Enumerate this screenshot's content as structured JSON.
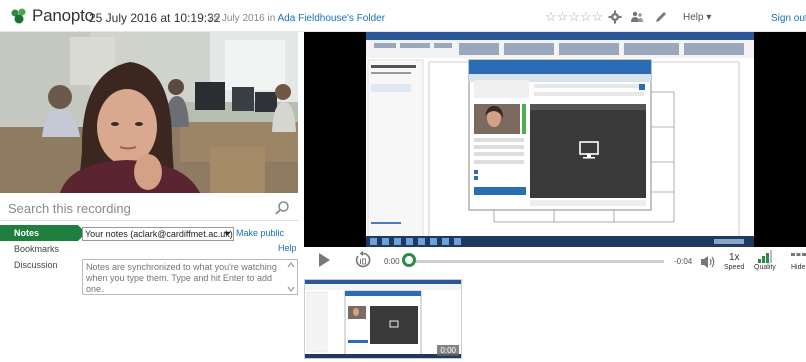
{
  "header": {
    "brand": "Panopto",
    "title": "25 July 2016 at 10:19:32",
    "subtitle_prefix": "25 July 2016 in",
    "folder": "Ada Fieldhouse's Folder",
    "rating_stars": "☆☆☆☆☆",
    "help_label": "Help ▾",
    "sign_out": "Sign out"
  },
  "search": {
    "placeholder": "Search this recording"
  },
  "tabs": [
    {
      "label": "Notes",
      "active": true
    },
    {
      "label": "Bookmarks",
      "active": false
    },
    {
      "label": "Discussion",
      "active": false
    }
  ],
  "notes": {
    "selected_stream": "Your notes (aclark@cardiffmet.ac.uk)",
    "make_public": "Make public",
    "help": "Help",
    "placeholder": "Notes are synchronized to what you're watching when you type them. Type and hit Enter to add one."
  },
  "player": {
    "current_time": "0:00",
    "remaining_time": "-0:04",
    "progress": 0,
    "speed_value": "1x",
    "speed_label": "Speed",
    "quality_label": "Quality",
    "hide_label": "Hide"
  },
  "thumbnail": {
    "time": "0:00"
  },
  "colors": {
    "accent_green": "#1f7f3f",
    "link_blue": "#1a6ebd"
  }
}
